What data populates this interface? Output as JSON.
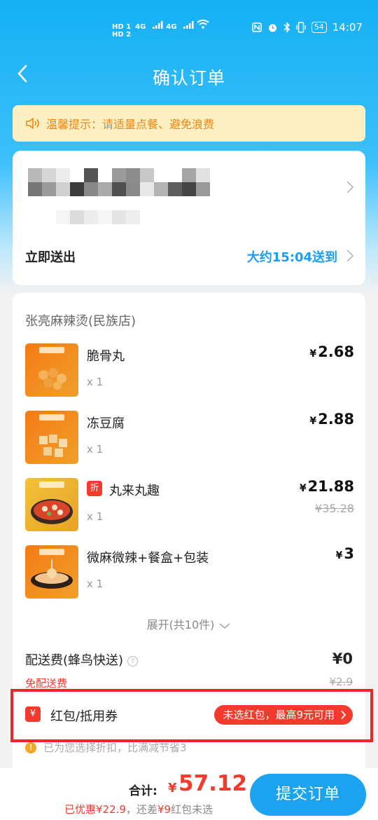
{
  "status": {
    "sim1": "HD 1",
    "sim2": "HD 2",
    "signal1": "4G",
    "signal2": "4G",
    "battery": "54",
    "time": "14:07"
  },
  "nav": {
    "title": "确认订单"
  },
  "tip": {
    "text": "温馨提示：请适量点餐、避免浪费"
  },
  "delivery": {
    "label": "立即送出",
    "time": "大约15:04送到"
  },
  "shop": {
    "name": "张亮麻辣烫(民族店)"
  },
  "items": [
    {
      "name": "脆骨丸",
      "qty": "x 1",
      "price": "2.68",
      "currency": "¥"
    },
    {
      "name": "冻豆腐",
      "qty": "x 1",
      "price": "2.88",
      "currency": "¥"
    },
    {
      "name": "丸来丸趣",
      "badge": "折",
      "qty": "x 1",
      "price": "21.88",
      "orig_price": "¥35.28",
      "currency": "¥"
    },
    {
      "name": "微麻微辣+餐盒+包装",
      "qty": "x 1",
      "price": "3",
      "currency": "¥"
    }
  ],
  "expand": {
    "label": "展开(共10件)"
  },
  "fee": {
    "label": "配送费(蜂鸟快送)",
    "help": "?",
    "value": "¥0",
    "free_tag": "免配送费",
    "orig": "¥2.9"
  },
  "coupon": {
    "icon": "¥",
    "label": "红包/抵用券",
    "pill": "未选红包，最高9元可用"
  },
  "note": {
    "icon": "!",
    "text": "已为您选择折扣，比满减节省3"
  },
  "footer": {
    "total_label": "合计:",
    "total_currency": "¥",
    "total_value": "57.12",
    "saved": "已优惠¥22.9",
    "remain": "，还差",
    "remain_amount": "¥9",
    "remain_suffix": "红包未选",
    "submit": "提交订单"
  },
  "colors": {
    "accent_blue": "#1ba3f0",
    "red": "#f43a2c",
    "tip_bg": "#fcefc2",
    "tip_text": "#f0850e"
  }
}
